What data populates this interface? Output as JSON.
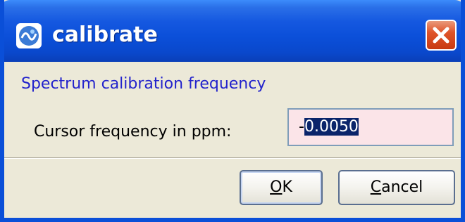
{
  "window": {
    "title": "calibrate",
    "icon": "app-logo-icon",
    "close_icon": "close-icon",
    "titlebar_color": "#0a4fd8",
    "close_color": "#e0542a"
  },
  "dialog": {
    "heading": "Spectrum calibration frequency",
    "heading_color": "#2222cc",
    "field_label": "Cursor frequency in ppm:",
    "field_value_prefix": "-",
    "field_value_selected": "0.0050",
    "field_bg_color": "#fbe4e8"
  },
  "buttons": {
    "ok_mnemonic": "O",
    "ok_rest": "K",
    "cancel_mnemonic": "C",
    "cancel_rest": "ancel"
  }
}
